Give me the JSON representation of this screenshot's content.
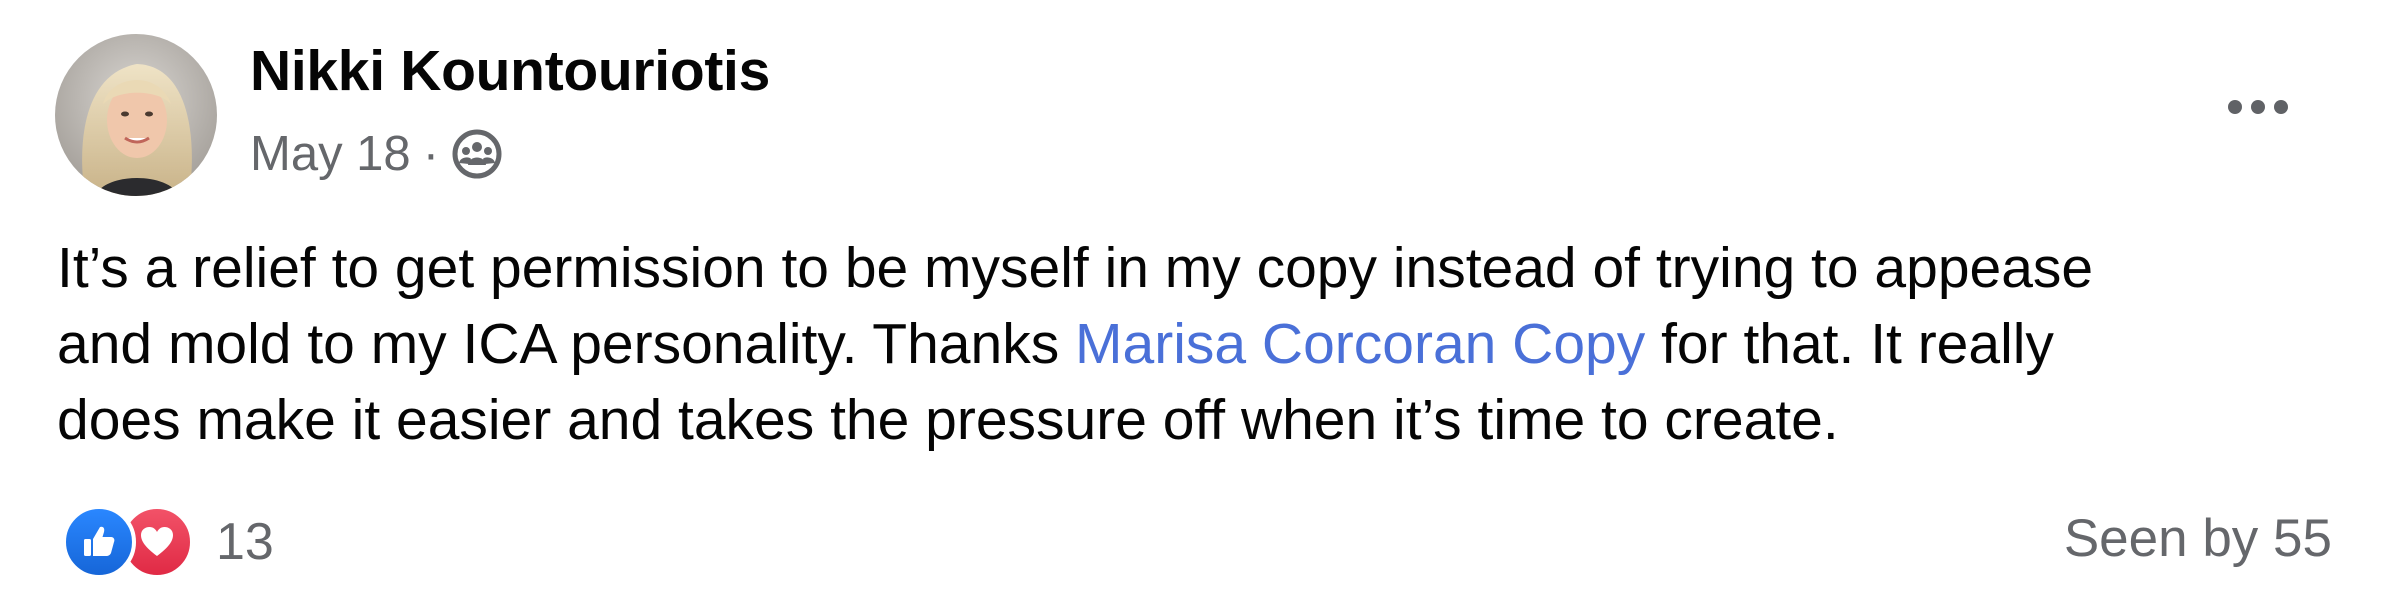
{
  "post": {
    "author": "Nikki Kountouriotis",
    "date": "May 18",
    "separator": "·",
    "audience_icon": "group-audience-icon",
    "more_icon": "more-options-icon",
    "body": {
      "line1": "It’s a relief to get permission to be myself in my copy instead of trying to appease",
      "line2_before": "and mold to my ICA personality. Thanks ",
      "line2_mention": "Marisa Corcoran Copy",
      "line2_after": " for that. It really",
      "line3": "does make it easier and takes the pressure off when it’s time to create."
    },
    "reactions": {
      "icons": [
        "like-icon",
        "love-icon"
      ],
      "count": "13"
    },
    "seen_by": "Seen by 55"
  },
  "colors": {
    "text": "#050505",
    "secondary": "#65676b",
    "mention": "#4a70d8",
    "like": "#1877f2",
    "love": "#e02a45"
  }
}
